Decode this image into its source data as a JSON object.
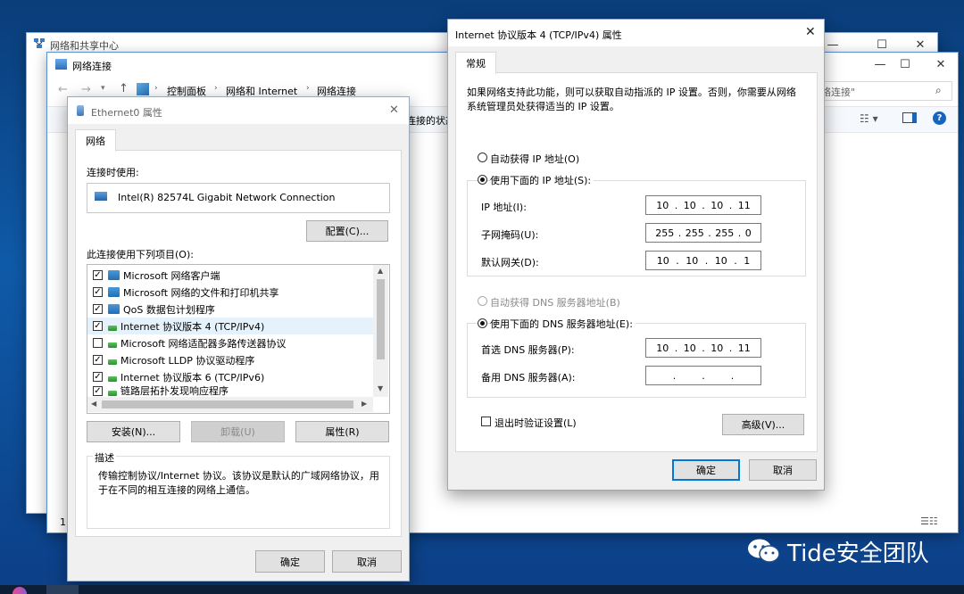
{
  "background_window": {
    "title": "网络和共享中心"
  },
  "explorer": {
    "title": "网络连接",
    "breadcrumb": [
      "控制面板",
      "网络和 Internet",
      "网络连接"
    ],
    "search_placeholder": "络连接\"",
    "toolbar_partial": "连接的状态",
    "status_left": "1"
  },
  "ethernet_dialog": {
    "title": "Ethernet0 属性",
    "tab": "网络",
    "connect_using_label": "连接时使用:",
    "adapter_name": "Intel(R) 82574L Gigabit Network Connection",
    "configure_button": "配置(C)...",
    "items_label": "此连接使用下列项目(O):",
    "items": [
      {
        "label": "Microsoft 网络客户端",
        "checked": true,
        "icon": "network-client-icon"
      },
      {
        "label": "Microsoft 网络的文件和打印机共享",
        "checked": true,
        "icon": "file-share-icon"
      },
      {
        "label": "QoS 数据包计划程序",
        "checked": true,
        "icon": "qos-icon"
      },
      {
        "label": "Internet 协议版本 4 (TCP/IPv4)",
        "checked": true,
        "icon": "protocol-icon",
        "selected": true
      },
      {
        "label": "Microsoft 网络适配器多路传送器协议",
        "checked": false,
        "icon": "protocol-icon"
      },
      {
        "label": "Microsoft LLDP 协议驱动程序",
        "checked": true,
        "icon": "protocol-icon"
      },
      {
        "label": "Internet 协议版本 6 (TCP/IPv6)",
        "checked": true,
        "icon": "protocol-icon"
      },
      {
        "label": "链路层拓扑发现响应程序",
        "checked": true,
        "icon": "protocol-icon"
      }
    ],
    "install_button": "安装(N)...",
    "uninstall_button": "卸载(U)",
    "properties_button": "属性(R)",
    "description_label": "描述",
    "description_text": "传输控制协议/Internet 协议。该协议是默认的广域网络协议，用于在不同的相互连接的网络上通信。",
    "ok_button": "确定",
    "cancel_button": "取消"
  },
  "ipv4_dialog": {
    "title": "Internet 协议版本 4 (TCP/IPv4) 属性",
    "tab": "常规",
    "intro": "如果网络支持此功能，则可以获取自动指派的 IP 设置。否则，你需要从网络系统管理员处获得适当的 IP 设置。",
    "auto_ip_label": "自动获得 IP 地址(O)",
    "manual_ip_label": "使用下面的 IP 地址(S):",
    "ip_label": "IP 地址(I):",
    "ip_value": [
      "10",
      "10",
      "10",
      "11"
    ],
    "mask_label": "子网掩码(U):",
    "mask_value": [
      "255",
      "255",
      "255",
      "0"
    ],
    "gateway_label": "默认网关(D):",
    "gateway_value": [
      "10",
      "10",
      "10",
      "1"
    ],
    "auto_dns_label": "自动获得 DNS 服务器地址(B)",
    "manual_dns_label": "使用下面的 DNS 服务器地址(E):",
    "preferred_dns_label": "首选 DNS 服务器(P):",
    "preferred_dns_value": [
      "10",
      "10",
      "10",
      "11"
    ],
    "alternate_dns_label": "备用 DNS 服务器(A):",
    "alternate_dns_value": [
      "",
      "",
      "",
      ""
    ],
    "validate_label": "退出时验证设置(L)",
    "advanced_button": "高级(V)...",
    "ok_button": "确定",
    "cancel_button": "取消"
  },
  "watermark": {
    "text": "Tide安全团队"
  }
}
